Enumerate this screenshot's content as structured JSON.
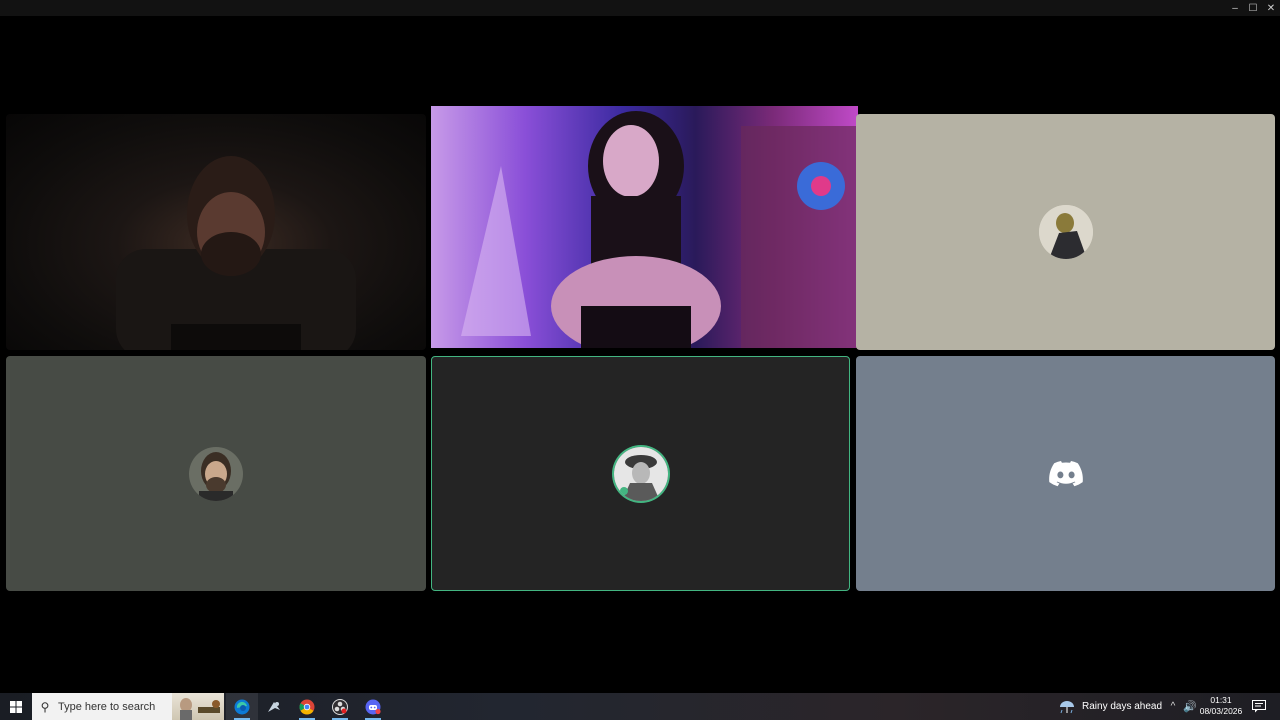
{
  "window": {
    "controls": {
      "minimize": "–",
      "maximize": "☐",
      "close": "✕"
    }
  },
  "participants": [
    {
      "id": 1,
      "type": "video",
      "description_icon": "camera-feed"
    },
    {
      "id": 2,
      "type": "video",
      "description_icon": "camera-feed"
    },
    {
      "id": 3,
      "type": "avatar",
      "avatar_icon": "figure-portrait-avatar"
    },
    {
      "id": 4,
      "type": "avatar",
      "avatar_icon": "bearded-man-avatar"
    },
    {
      "id": 5,
      "type": "avatar",
      "avatar_icon": "officer-cap-avatar",
      "speaking": true
    },
    {
      "id": 6,
      "type": "avatar",
      "avatar_icon": "discord-logo-icon"
    }
  ],
  "colors": {
    "speaking_border": "#43b581",
    "tile_3_bg": "#b5b2a4",
    "tile_4_bg": "#474b45",
    "tile_5_bg": "#242424",
    "tile_6_bg": "#747f8d"
  },
  "taskbar": {
    "search_placeholder": "Type here to search",
    "apps": [
      "edge-icon",
      "steam-icon",
      "chrome-icon",
      "obs-icon",
      "discord-icon"
    ],
    "weather_text": "Rainy days ahead",
    "clock_time": "01:31",
    "clock_date": "08/03/2026"
  }
}
